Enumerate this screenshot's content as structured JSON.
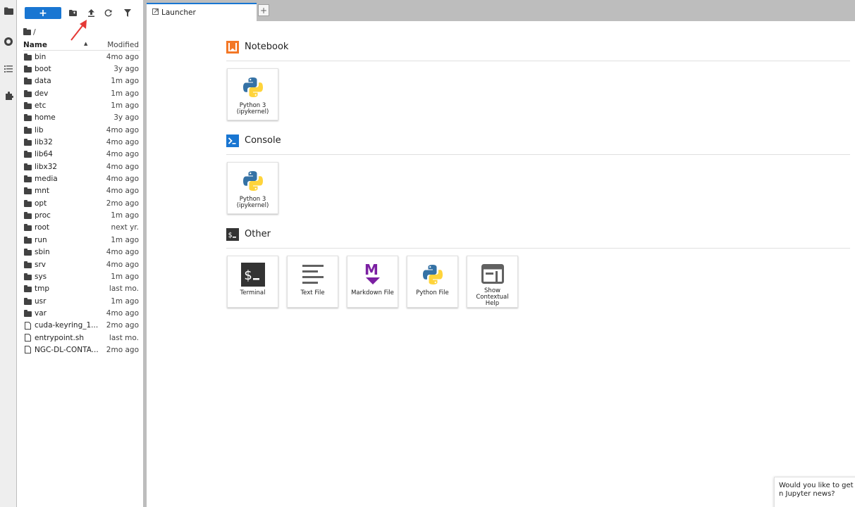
{
  "file_browser": {
    "breadcrumb": "/",
    "header": {
      "name": "Name",
      "modified": "Modified",
      "sort_indicator": "▲"
    },
    "new_launcher_label": "+",
    "toolbar_icons": [
      "new-folder-icon",
      "upload-icon",
      "refresh-icon",
      "filter-icon"
    ],
    "files": [
      {
        "name": "bin",
        "modified": "4mo ago",
        "type": "folder"
      },
      {
        "name": "boot",
        "modified": "3y ago",
        "type": "folder"
      },
      {
        "name": "data",
        "modified": "1m ago",
        "type": "folder"
      },
      {
        "name": "dev",
        "modified": "1m ago",
        "type": "folder"
      },
      {
        "name": "etc",
        "modified": "1m ago",
        "type": "folder"
      },
      {
        "name": "home",
        "modified": "3y ago",
        "type": "folder"
      },
      {
        "name": "lib",
        "modified": "4mo ago",
        "type": "folder"
      },
      {
        "name": "lib32",
        "modified": "4mo ago",
        "type": "folder"
      },
      {
        "name": "lib64",
        "modified": "4mo ago",
        "type": "folder"
      },
      {
        "name": "libx32",
        "modified": "4mo ago",
        "type": "folder"
      },
      {
        "name": "media",
        "modified": "4mo ago",
        "type": "folder"
      },
      {
        "name": "mnt",
        "modified": "4mo ago",
        "type": "folder"
      },
      {
        "name": "opt",
        "modified": "2mo ago",
        "type": "folder"
      },
      {
        "name": "proc",
        "modified": "1m ago",
        "type": "folder"
      },
      {
        "name": "root",
        "modified": "next yr.",
        "type": "folder"
      },
      {
        "name": "run",
        "modified": "1m ago",
        "type": "folder"
      },
      {
        "name": "sbin",
        "modified": "4mo ago",
        "type": "folder"
      },
      {
        "name": "srv",
        "modified": "4mo ago",
        "type": "folder"
      },
      {
        "name": "sys",
        "modified": "1m ago",
        "type": "folder"
      },
      {
        "name": "tmp",
        "modified": "last mo.",
        "type": "folder"
      },
      {
        "name": "usr",
        "modified": "1m ago",
        "type": "folder"
      },
      {
        "name": "var",
        "modified": "4mo ago",
        "type": "folder"
      },
      {
        "name": "cuda-keyring_1....",
        "modified": "2mo ago",
        "type": "file"
      },
      {
        "name": "entrypoint.sh",
        "modified": "last mo.",
        "type": "file"
      },
      {
        "name": "NGC-DL-CONTA...",
        "modified": "2mo ago",
        "type": "file"
      }
    ]
  },
  "tabs": {
    "launcher_label": "Launcher",
    "add_label": "+"
  },
  "launcher": {
    "sections": [
      {
        "title": "Notebook",
        "cards": [
          {
            "label": "Python 3 (ipykernel)",
            "icon": "python-logo-icon"
          }
        ]
      },
      {
        "title": "Console",
        "cards": [
          {
            "label": "Python 3 (ipykernel)",
            "icon": "python-logo-icon"
          }
        ]
      },
      {
        "title": "Other",
        "cards": [
          {
            "label": "Terminal",
            "icon": "terminal-icon"
          },
          {
            "label": "Text File",
            "icon": "text-file-icon"
          },
          {
            "label": "Markdown File",
            "icon": "markdown-icon"
          },
          {
            "label": "Python File",
            "icon": "python-logo-icon"
          },
          {
            "label": "Show Contextual Help",
            "icon": "contextual-help-icon"
          }
        ]
      }
    ]
  },
  "toast": {
    "text": "Would you like to get n Jupyter news?"
  },
  "colors": {
    "accent": "#1976d2",
    "notebook": "#f37726",
    "console": "#1976d2",
    "other": "#333333",
    "markdown": "#7b1fa2"
  }
}
